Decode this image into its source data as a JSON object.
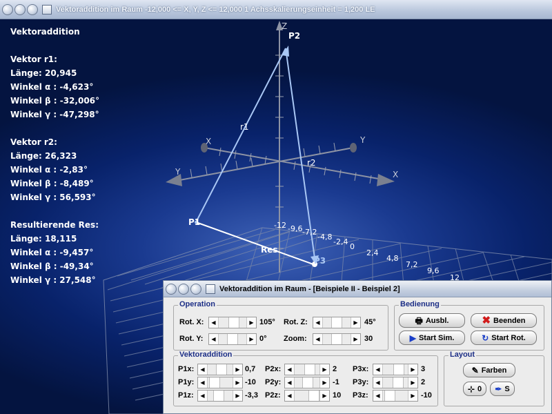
{
  "main_window": {
    "title": "Vektoraddition im Raum   -12,000 <= X, Y, Z <= 12,000   1 Achsskalierungseinheit = 1,200 LE"
  },
  "info_panel": {
    "heading": "Vektoraddition",
    "r1_title": "Vektor r1:",
    "r1_length": "Länge: 20,945",
    "r1_alpha": "Winkel α : -4,623°",
    "r1_beta": "Winkel β : -32,006°",
    "r1_gamma": "Winkel γ : -47,298°",
    "r2_title": "Vektor r2:",
    "r2_length": "Länge: 26,323",
    "r2_alpha": "Winkel α : -2,83°",
    "r2_beta": "Winkel β : -8,489°",
    "r2_gamma": "Winkel γ : 56,593°",
    "res_title": "Resultierende Res:",
    "res_length": "Länge: 18,115",
    "res_alpha": "Winkel α : -9,457°",
    "res_beta": "Winkel β : -49,34°",
    "res_gamma": "Winkel γ : 27,548°"
  },
  "scene": {
    "axis_labels": {
      "z": "Z",
      "x_back": "X",
      "y_back": "Y",
      "y_front": "Y",
      "x_front": "X"
    },
    "point_labels": {
      "p1": "P1",
      "p2": "P2",
      "p3": "P3"
    },
    "vector_labels": {
      "r1": "r1",
      "r2": "r2",
      "res": "Res"
    },
    "tick_labels": [
      "-12",
      "-9,6",
      "-7,2",
      "-4,8",
      "-2,4",
      "0",
      "2,4",
      "4,8",
      "7,2",
      "9,6",
      "12"
    ],
    "colors": {
      "vectors": "#a9c7f5",
      "result": "#ffffff",
      "axes": "#8d93a4",
      "grid": "#7d8aa8"
    }
  },
  "dialog": {
    "title": "Vektoraddition im Raum - [Beispiele II - Beispiel 2]",
    "operation": {
      "label": "Operation",
      "rot_x_label": "Rot. X:",
      "rot_x_value": "105°",
      "rot_z_label": "Rot. Z:",
      "rot_z_value": "45°",
      "rot_y_label": "Rot. Y:",
      "rot_y_value": "0°",
      "zoom_label": "Zoom:",
      "zoom_value": "30"
    },
    "bedienung": {
      "label": "Bedienung",
      "ausbl": "Ausbl.",
      "beenden": "Beenden",
      "start_sim": "Start Sim.",
      "start_rot": "Start Rot."
    },
    "vektoraddition": {
      "label": "Vektoraddition",
      "p1x_label": "P1x:",
      "p1x_value": "0,7",
      "p1y_label": "P1y:",
      "p1y_value": "-10",
      "p1z_label": "P1z:",
      "p1z_value": "-3,3",
      "p2x_label": "P2x:",
      "p2x_value": "2",
      "p2y_label": "P2y:",
      "p2y_value": "-1",
      "p2z_label": "P2z:",
      "p2z_value": "10",
      "p3x_label": "P3x:",
      "p3x_value": "3",
      "p3y_label": "P3y:",
      "p3y_value": "2",
      "p3z_label": "P3z:",
      "p3z_value": "-10"
    },
    "layout": {
      "label": "Layout",
      "farben": "Farben",
      "zero": "0",
      "s": "S"
    }
  }
}
